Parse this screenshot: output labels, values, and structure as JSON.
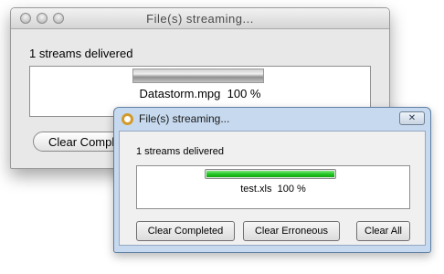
{
  "back_window": {
    "title": "File(s) streaming...",
    "status": "1 streams delivered",
    "transfer": {
      "file": "Datastorm.mpg",
      "percent_label": "100 %",
      "progress": 1.0
    },
    "button_label": "Clear Comple"
  },
  "front_window": {
    "title": "File(s) streaming...",
    "status": "1 streams delivered",
    "transfer": {
      "file": "test.xls",
      "percent_label": "100 %",
      "progress": 1.0
    },
    "buttons": {
      "clear_completed": "Clear Completed",
      "clear_erroneous": "Clear Erroneous",
      "clear_all": "Clear All"
    },
    "close_glyph": "✕",
    "progress_color": "#1ec41e"
  }
}
